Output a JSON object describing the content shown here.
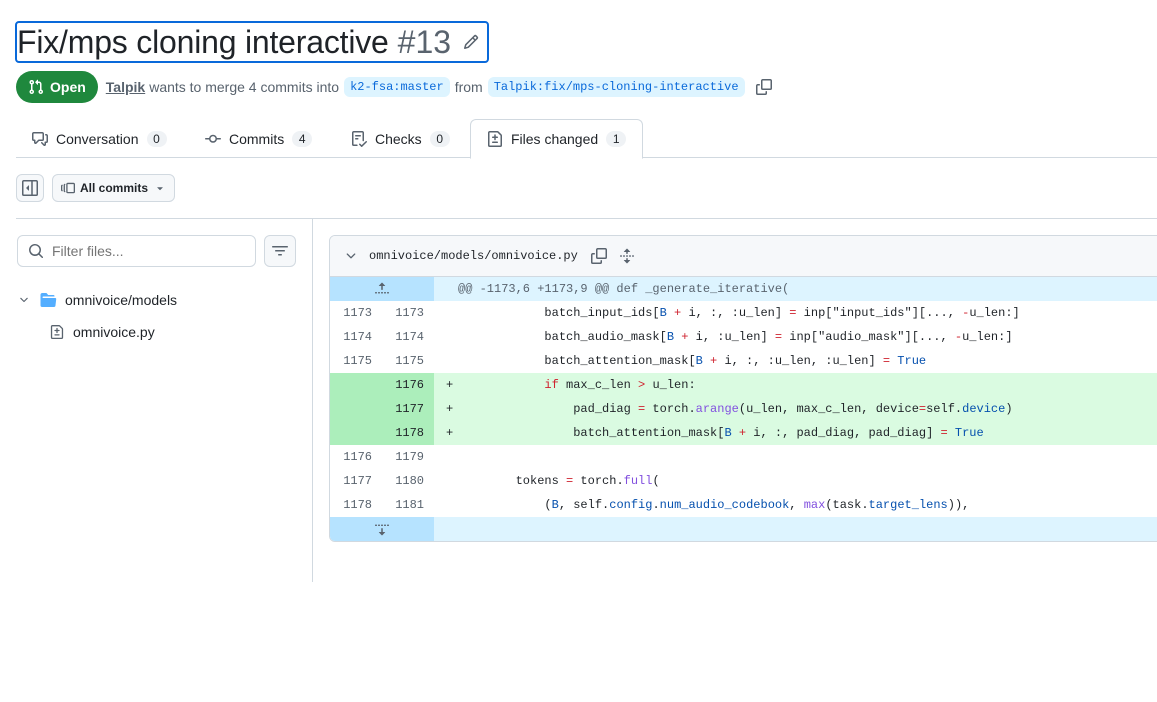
{
  "pr": {
    "title": "Fix/mps cloning interactive",
    "number": "#13",
    "state": "Open",
    "author": "Talpik",
    "merge_text": "wants to merge 4 commits into",
    "base_branch": "k2-fsa:master",
    "from_text": "from",
    "head_branch": "Talpik:fix/mps-cloning-interactive"
  },
  "tabs": [
    {
      "label": "Conversation",
      "count": "0"
    },
    {
      "label": "Commits",
      "count": "4"
    },
    {
      "label": "Checks",
      "count": "0"
    },
    {
      "label": "Files changed",
      "count": "1"
    }
  ],
  "toolbar": {
    "commits_label": "All commits"
  },
  "file_tree": {
    "filter_placeholder": "Filter files...",
    "directory": "omnivoice/models",
    "file": "omnivoice.py"
  },
  "diff": {
    "path": "omnivoice/models/omnivoice.py",
    "hunk_header": "@@ -1173,6 +1173,9 @@ def _generate_iterative(",
    "lines": [
      {
        "old": "1173",
        "new": "1173",
        "sign": "",
        "tokens": [
          {
            "t": "            batch_input_ids["
          },
          {
            "t": "B",
            "c": "k-blue"
          },
          {
            "t": " "
          },
          {
            "t": "+",
            "c": "k-red"
          },
          {
            "t": " i, :, :u_len] "
          },
          {
            "t": "=",
            "c": "k-red"
          },
          {
            "t": " inp[\"input_ids\"][..., "
          },
          {
            "t": "-",
            "c": "k-red"
          },
          {
            "t": "u_len:]"
          }
        ]
      },
      {
        "old": "1174",
        "new": "1174",
        "sign": "",
        "tokens": [
          {
            "t": "            batch_audio_mask["
          },
          {
            "t": "B",
            "c": "k-blue"
          },
          {
            "t": " "
          },
          {
            "t": "+",
            "c": "k-red"
          },
          {
            "t": " i, :u_len] "
          },
          {
            "t": "=",
            "c": "k-red"
          },
          {
            "t": " inp[\"audio_mask\"][..., "
          },
          {
            "t": "-",
            "c": "k-red"
          },
          {
            "t": "u_len:]"
          }
        ]
      },
      {
        "old": "1175",
        "new": "1175",
        "sign": "",
        "tokens": [
          {
            "t": "            batch_attention_mask["
          },
          {
            "t": "B",
            "c": "k-blue"
          },
          {
            "t": " "
          },
          {
            "t": "+",
            "c": "k-red"
          },
          {
            "t": " i, :, :u_len, :u_len] "
          },
          {
            "t": "=",
            "c": "k-red"
          },
          {
            "t": " "
          },
          {
            "t": "True",
            "c": "k-blue"
          }
        ]
      },
      {
        "old": "",
        "new": "1176",
        "sign": "+",
        "tokens": [
          {
            "t": "            "
          },
          {
            "t": "if",
            "c": "k-red"
          },
          {
            "t": " max_c_len "
          },
          {
            "t": ">",
            "c": "k-red"
          },
          {
            "t": " u_len:"
          }
        ]
      },
      {
        "old": "",
        "new": "1177",
        "sign": "+",
        "tokens": [
          {
            "t": "                pad_diag "
          },
          {
            "t": "=",
            "c": "k-red"
          },
          {
            "t": " torch."
          },
          {
            "t": "arange",
            "c": "k-purple"
          },
          {
            "t": "(u_len, max_c_len, device"
          },
          {
            "t": "=",
            "c": "k-red"
          },
          {
            "t": "self."
          },
          {
            "t": "device",
            "c": "k-blue"
          },
          {
            "t": ")"
          }
        ]
      },
      {
        "old": "",
        "new": "1178",
        "sign": "+",
        "tokens": [
          {
            "t": "                batch_attention_mask["
          },
          {
            "t": "B",
            "c": "k-blue"
          },
          {
            "t": " "
          },
          {
            "t": "+",
            "c": "k-red"
          },
          {
            "t": " i, :, pad_diag, pad_diag] "
          },
          {
            "t": "=",
            "c": "k-red"
          },
          {
            "t": " "
          },
          {
            "t": "True",
            "c": "k-blue"
          }
        ]
      },
      {
        "old": "1176",
        "new": "1179",
        "sign": "",
        "tokens": [
          {
            "t": ""
          }
        ]
      },
      {
        "old": "1177",
        "new": "1180",
        "sign": "",
        "tokens": [
          {
            "t": "        tokens "
          },
          {
            "t": "=",
            "c": "k-red"
          },
          {
            "t": " torch."
          },
          {
            "t": "full",
            "c": "k-purple"
          },
          {
            "t": "("
          }
        ]
      },
      {
        "old": "1178",
        "new": "1181",
        "sign": "",
        "tokens": [
          {
            "t": "            ("
          },
          {
            "t": "B",
            "c": "k-blue"
          },
          {
            "t": ", self."
          },
          {
            "t": "config",
            "c": "k-blue"
          },
          {
            "t": "."
          },
          {
            "t": "num_audio_codebook",
            "c": "k-blue"
          },
          {
            "t": ", "
          },
          {
            "t": "max",
            "c": "k-purple"
          },
          {
            "t": "(task."
          },
          {
            "t": "target_lens",
            "c": "k-blue"
          },
          {
            "t": ")),"
          }
        ]
      }
    ]
  },
  "colors": {
    "accent": "#0969da",
    "open_green": "#1f883d",
    "addition_bg": "#dafbe1",
    "addition_gutter": "#aceebb",
    "hunk_bg": "#ddf4ff"
  }
}
